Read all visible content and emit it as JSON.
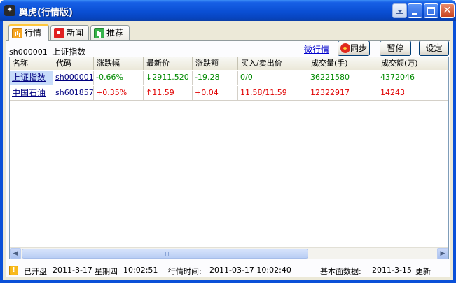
{
  "window": {
    "title": "翼虎(行情版)"
  },
  "tabs": [
    {
      "label": "行情",
      "icon": "market-chart-icon",
      "active": true
    },
    {
      "label": "新闻",
      "icon": "news-icon",
      "active": false
    },
    {
      "label": "推荐",
      "icon": "recommend-icon",
      "active": false
    }
  ],
  "toolbar": {
    "selected_code": "sh000001",
    "selected_name": "上证指数",
    "weibo_link": "微行情",
    "sync_label": "同步",
    "pause_label": "暂停",
    "settings_label": "设定"
  },
  "table": {
    "columns": [
      "名称",
      "代码",
      "涨跌幅",
      "最新价",
      "涨跌额",
      "买入/卖出价",
      "成交量(手)",
      "成交额(万)"
    ],
    "rows": [
      {
        "name": "上证指数",
        "code": "sh000001",
        "change_pct": "-0.66%",
        "arrow": "↓",
        "price": "2911.520",
        "change": "-19.28",
        "bid_ask": "0/0",
        "volume": "36221580",
        "amount": "4372046",
        "trend": "down"
      },
      {
        "name": "中国石油",
        "code": "sh601857",
        "change_pct": "+0.35%",
        "arrow": "↑",
        "price": "11.59",
        "change": "+0.04",
        "bid_ask": "11.58/11.59",
        "volume": "12322917",
        "amount": "14243",
        "trend": "up"
      }
    ]
  },
  "status": {
    "market_state": "已开盘",
    "date": "2011-3-17",
    "weekday": "星期四",
    "time": "10:02:51",
    "quote_time_label": "行情时间:",
    "quote_time": "2011-03-17 10:02:40",
    "fundamentals_label": "基本面数据:",
    "fundamentals_date": "2011-3-15",
    "fundamentals_state": "更新"
  },
  "colors": {
    "up": "#e00000",
    "down": "#008a00",
    "title_bar": "#0a4fd4"
  }
}
